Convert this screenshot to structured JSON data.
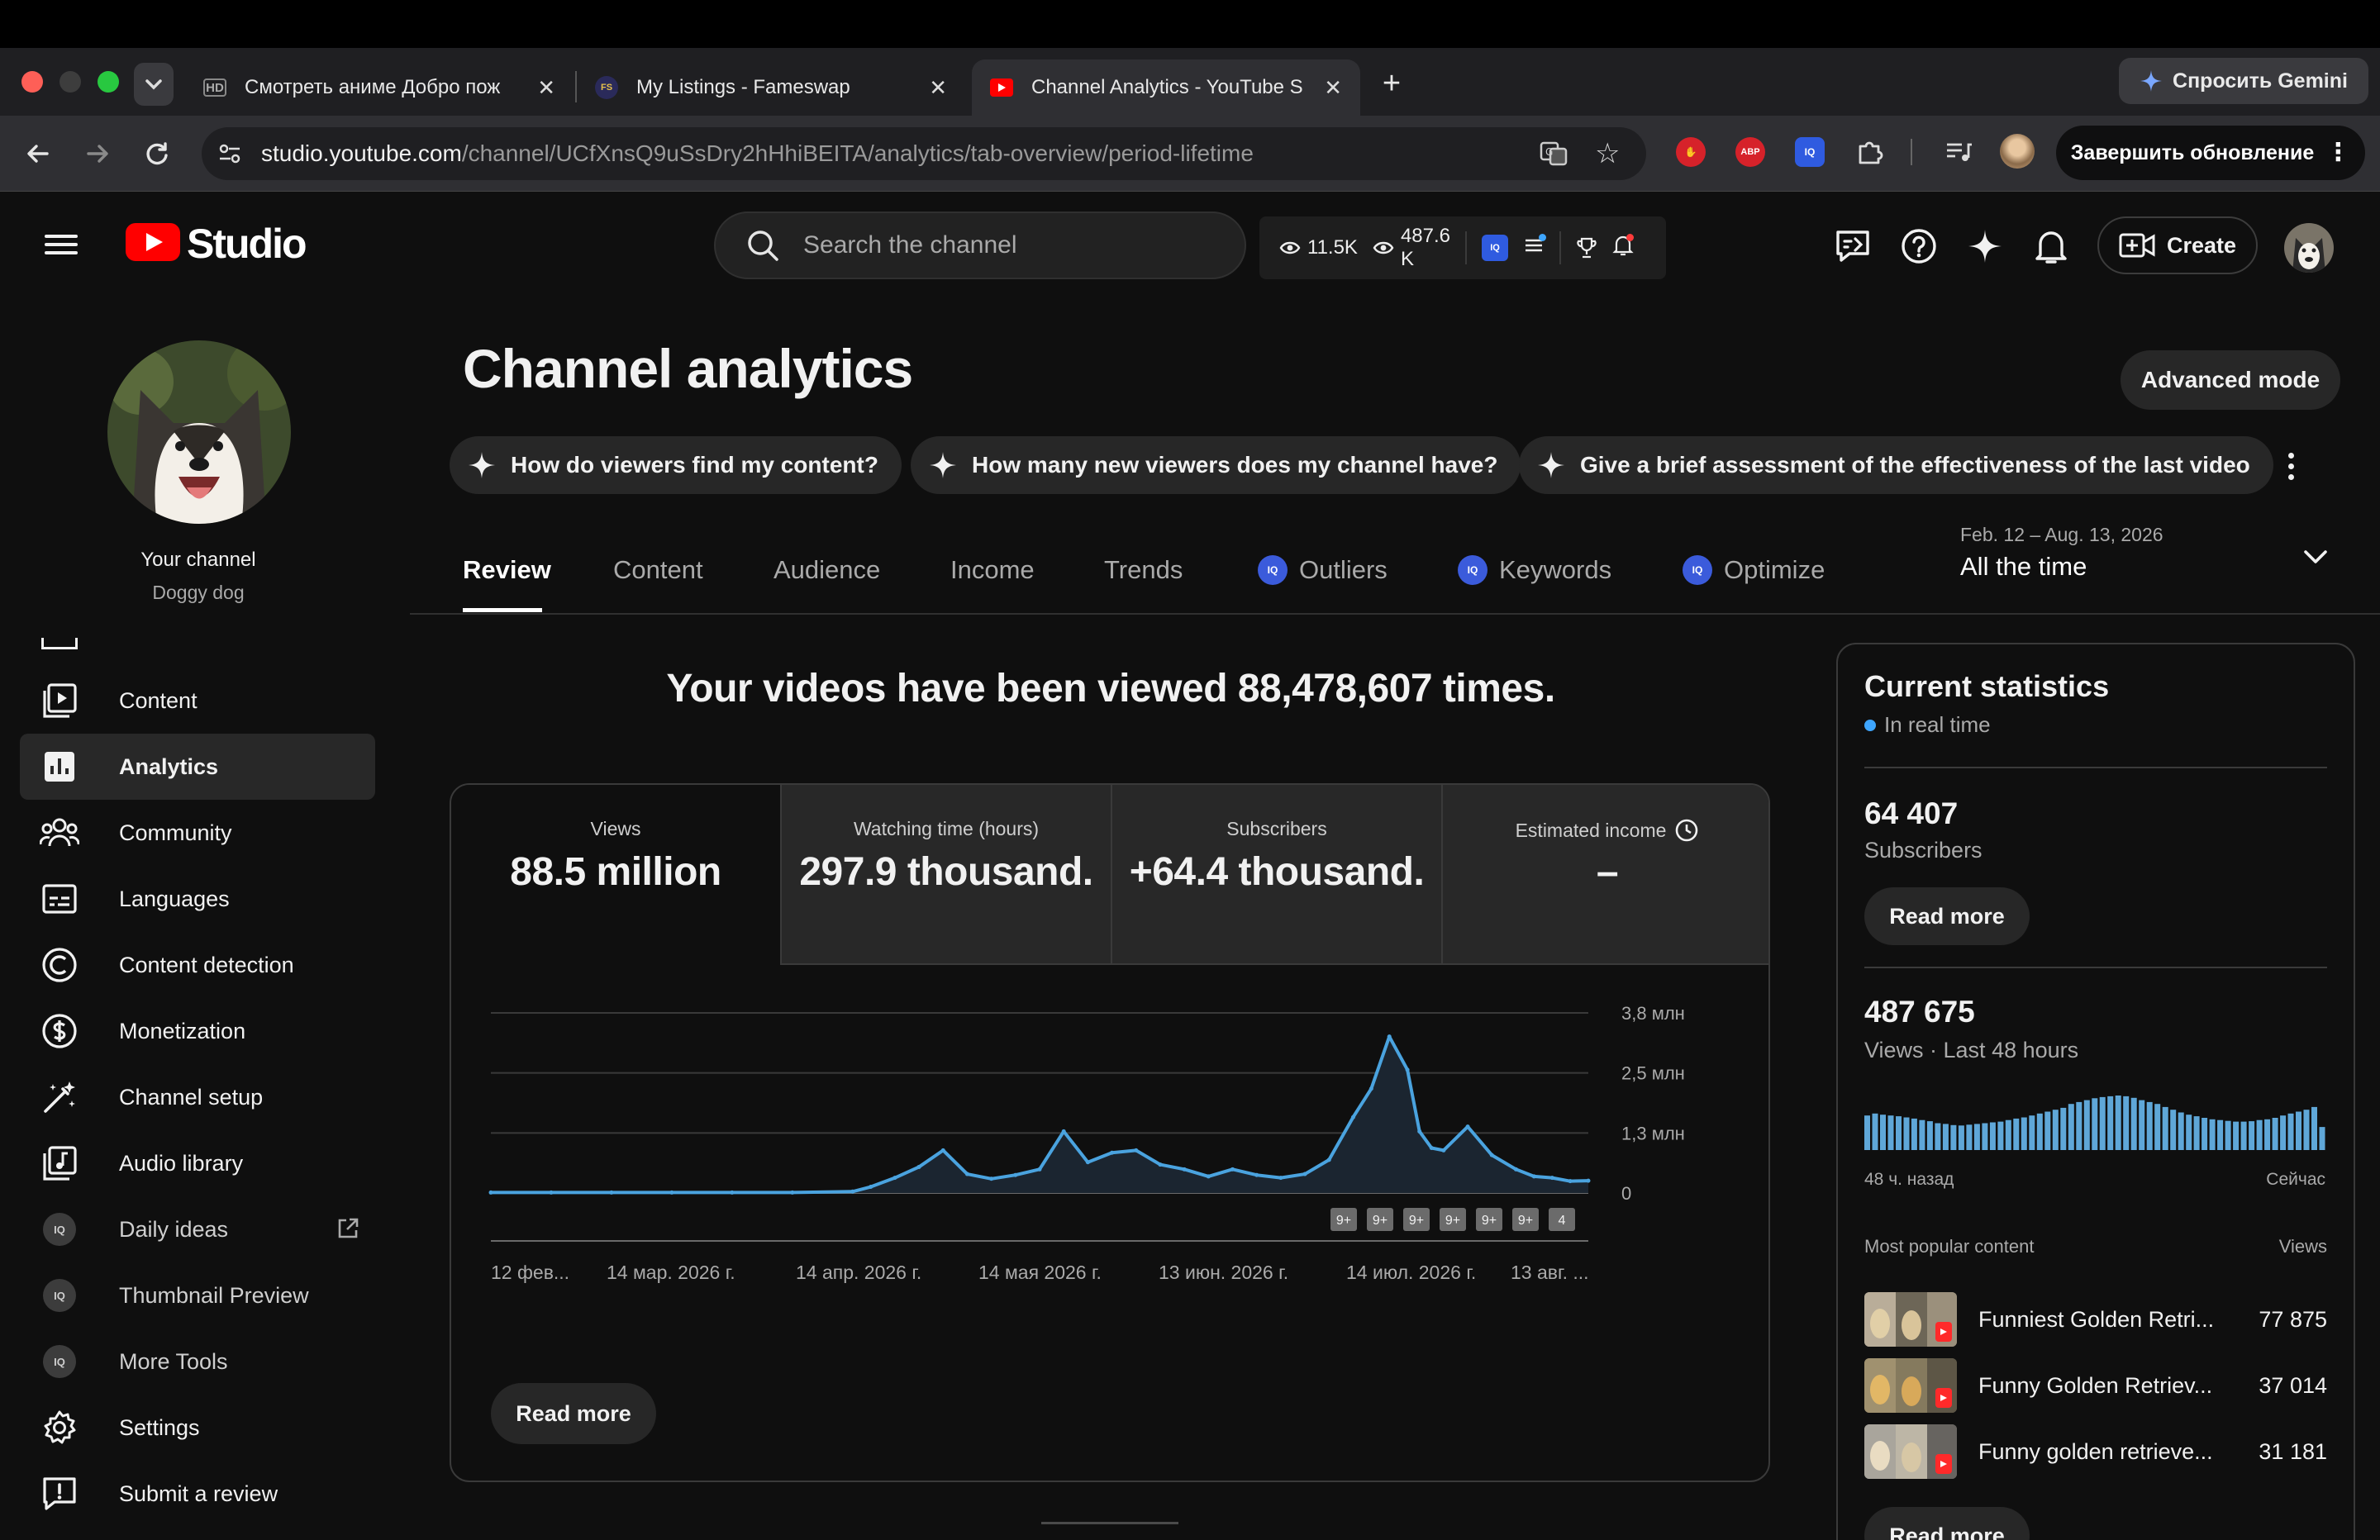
{
  "browser": {
    "tabs": [
      {
        "label": "Смотреть аниме Добро пож",
        "icon": "HD"
      },
      {
        "label": "My Listings - Fameswap",
        "icon": "FS"
      },
      {
        "label": "Channel Analytics - YouTube S",
        "icon": "YT"
      }
    ],
    "new_tab": "+",
    "gemini_label": "Спросить Gemini",
    "url_host": "studio.youtube.com",
    "url_path": "/channel/UCfXnsQ9uSsDry2hHhiBEITA/analytics/tab-overview/period-lifetime",
    "update_label": "Завершить обновление",
    "extensions": [
      "ABP",
      "IQ"
    ]
  },
  "header": {
    "brand": "Studio",
    "search_placeholder": "Search the channel",
    "stat_views": "11.5K",
    "stat_views2_line1": "487.6",
    "stat_views2_line2": "K",
    "create_label": "Create"
  },
  "sidebar": {
    "channel_label": "Your channel",
    "channel_name": "Doggy dog",
    "items": [
      {
        "label": "Content",
        "icon": "content-icon"
      },
      {
        "label": "Analytics",
        "icon": "analytics-icon",
        "active": true
      },
      {
        "label": "Community",
        "icon": "community-icon"
      },
      {
        "label": "Languages",
        "icon": "languages-icon"
      },
      {
        "label": "Content detection",
        "icon": "copyright-icon"
      },
      {
        "label": "Monetization",
        "icon": "dollar-icon"
      },
      {
        "label": "Channel setup",
        "icon": "magic-wand-icon"
      },
      {
        "label": "Audio library",
        "icon": "audio-library-icon"
      },
      {
        "label": "Daily ideas",
        "icon": "iq-icon"
      },
      {
        "label": "Thumbnail Preview",
        "icon": "iq-icon"
      },
      {
        "label": "More Tools",
        "icon": "iq-icon"
      },
      {
        "label": "Settings",
        "icon": "gear-icon"
      },
      {
        "label": "Submit a review",
        "icon": "feedback-icon"
      }
    ],
    "iq_badge": "IQ"
  },
  "main": {
    "title": "Channel analytics",
    "advanced_mode": "Advanced mode",
    "chips": [
      "How do viewers find my content?",
      "How many new viewers does my channel have?",
      "Give a brief assessment of the effectiveness of the last video"
    ],
    "tabs": [
      {
        "label": "Review",
        "active": true
      },
      {
        "label": "Content"
      },
      {
        "label": "Audience"
      },
      {
        "label": "Income"
      },
      {
        "label": "Trends"
      },
      {
        "label": "Outliers",
        "iq": true
      },
      {
        "label": "Keywords",
        "iq": true
      },
      {
        "label": "Optimize",
        "iq": true
      }
    ],
    "period_range": "Feb. 12 – Aug. 13, 2026",
    "period_value": "All the time",
    "headline": "Your videos have been viewed 88,478,607 times.",
    "metrics": [
      {
        "label": "Views",
        "value": "88.5 million"
      },
      {
        "label": "Watching time (hours)",
        "value": "297.9 thousand."
      },
      {
        "label": "Subscribers",
        "value": "+64.4 thousand."
      },
      {
        "label": "Estimated income",
        "value": "–"
      }
    ],
    "read_more": "Read more"
  },
  "chart_data": {
    "type": "area",
    "x_ticks": [
      "12 фев...",
      "14 мар. 2026 г.",
      "14 апр. 2026 г.",
      "14 мая 2026 г.",
      "13 июн. 2026 г.",
      "14 июл. 2026 г.",
      "13 авг. ..."
    ],
    "y_ticks": [
      "0",
      "1,3 млн",
      "2,5 млн",
      "3,8 млн"
    ],
    "ylim": [
      0,
      3800000
    ],
    "x": [
      "2026-02-12",
      "2026-02-22",
      "2026-03-04",
      "2026-03-14",
      "2026-03-24",
      "2026-04-03",
      "2026-04-13",
      "2026-04-16",
      "2026-04-20",
      "2026-04-24",
      "2026-04-28",
      "2026-05-02",
      "2026-05-06",
      "2026-05-10",
      "2026-05-14",
      "2026-05-18",
      "2026-05-22",
      "2026-05-26",
      "2026-05-30",
      "2026-06-03",
      "2026-06-07",
      "2026-06-11",
      "2026-06-15",
      "2026-06-19",
      "2026-06-23",
      "2026-06-27",
      "2026-07-01",
      "2026-07-05",
      "2026-07-08",
      "2026-07-11",
      "2026-07-14",
      "2026-07-16",
      "2026-07-18",
      "2026-07-20",
      "2026-07-24",
      "2026-07-28",
      "2026-08-01",
      "2026-08-04",
      "2026-08-07",
      "2026-08-10",
      "2026-08-13"
    ],
    "values": [
      10000,
      10000,
      10000,
      10000,
      10000,
      10000,
      30000,
      130000,
      320000,
      550000,
      900000,
      400000,
      300000,
      380000,
      500000,
      1300000,
      650000,
      850000,
      900000,
      600000,
      500000,
      350000,
      500000,
      380000,
      320000,
      400000,
      700000,
      1600000,
      2200000,
      3300000,
      2600000,
      1300000,
      950000,
      900000,
      1400000,
      800000,
      500000,
      350000,
      320000,
      250000,
      260000
    ],
    "annotations": [
      "9+",
      "9+",
      "9+",
      "9+",
      "9+",
      "9+",
      "4"
    ],
    "grid": true,
    "color": "#4aa3df"
  },
  "right_panel": {
    "title": "Current statistics",
    "subtitle": "In real time",
    "subscribers_value": "64 407",
    "subscribers_label": "Subscribers",
    "read_more": "Read more",
    "views_value": "487 675",
    "views_label": "Views · Last 48 hours",
    "views_48h": [
      0.9,
      0.95,
      0.92,
      0.9,
      0.88,
      0.85,
      0.82,
      0.78,
      0.75,
      0.7,
      0.68,
      0.65,
      0.64,
      0.66,
      0.68,
      0.7,
      0.72,
      0.74,
      0.78,
      0.82,
      0.85,
      0.9,
      0.95,
      1.0,
      1.05,
      1.1,
      1.2,
      1.25,
      1.3,
      1.35,
      1.38,
      1.4,
      1.42,
      1.4,
      1.36,
      1.3,
      1.25,
      1.2,
      1.12,
      1.05,
      0.98,
      0.92,
      0.88,
      0.84,
      0.8,
      0.78,
      0.76,
      0.74,
      0.74,
      0.75,
      0.78,
      0.8,
      0.84,
      0.9,
      0.95,
      1.0,
      1.05,
      1.12,
      0.6
    ],
    "ago_label": "48 ч. назад",
    "now_label": "Сейчас",
    "popular_header": "Most popular content",
    "popular_views_header": "Views",
    "popular": [
      {
        "title": "Funniest Golden Retri...",
        "views": "77 875"
      },
      {
        "title": "Funny Golden Retriev...",
        "views": "37 014"
      },
      {
        "title": "Funny golden retrieve...",
        "views": "31 181"
      }
    ]
  },
  "colors": {
    "accent": "#3ea6ff",
    "chart": "#4aa3df",
    "yt_red": "#ff0000",
    "iq_blue": "#3b5bdb"
  }
}
